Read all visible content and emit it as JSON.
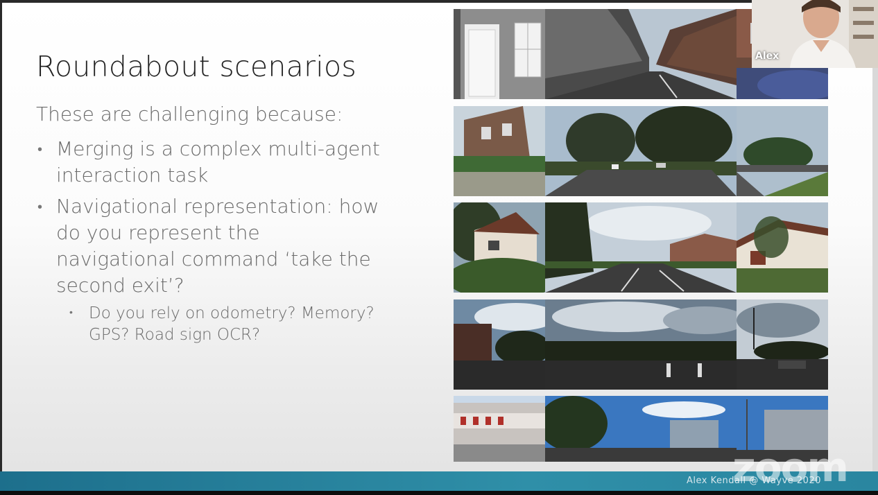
{
  "slide": {
    "title": "Roundabout scenarios",
    "intro": "These are challenging because:",
    "bullets": [
      "Merging is a complex multi-agent interaction task",
      "Navigational representation: how do you represent the navigational command ‘take the second exit’?"
    ],
    "sub_bullets": [
      "Do you rely on odometry? Memory? GPS? Road sign OCR?"
    ],
    "bullet_glyph": "•",
    "image_rows": 5,
    "footer": "Alex Kendall @ Wayve 2020"
  },
  "participant": {
    "name": "Alex"
  },
  "watermark": "zoom",
  "colors": {
    "footer_bar": "#2a86a0",
    "title_text": "#222222",
    "body_text": "#6a6a6a"
  }
}
